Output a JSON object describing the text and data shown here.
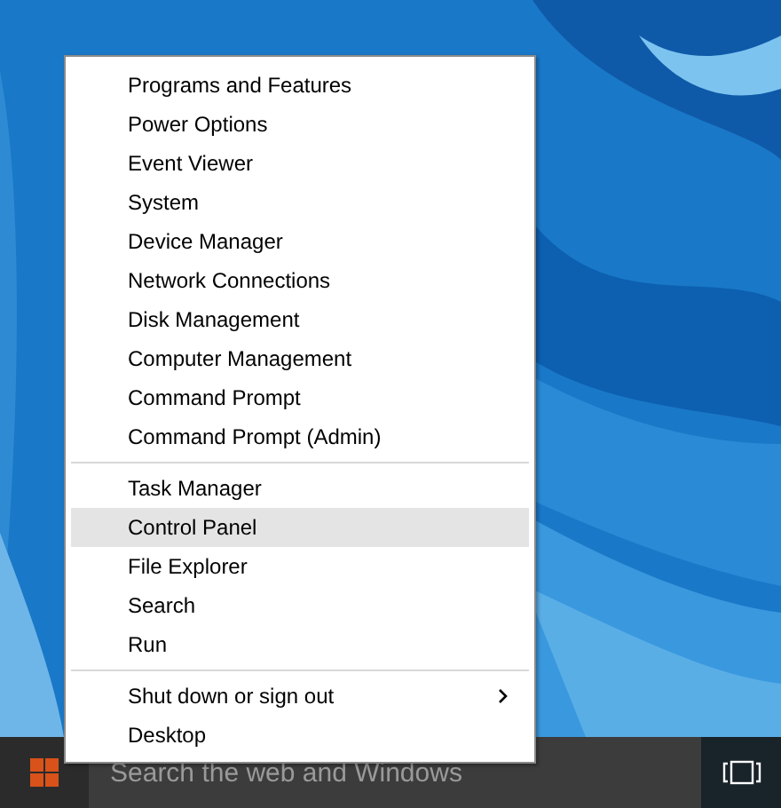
{
  "menu": {
    "groups": [
      {
        "items": [
          {
            "label": "Programs and Features",
            "selected": false,
            "has_submenu": false
          },
          {
            "label": "Power Options",
            "selected": false,
            "has_submenu": false
          },
          {
            "label": "Event Viewer",
            "selected": false,
            "has_submenu": false
          },
          {
            "label": "System",
            "selected": false,
            "has_submenu": false
          },
          {
            "label": "Device Manager",
            "selected": false,
            "has_submenu": false
          },
          {
            "label": "Network Connections",
            "selected": false,
            "has_submenu": false
          },
          {
            "label": "Disk Management",
            "selected": false,
            "has_submenu": false
          },
          {
            "label": "Computer Management",
            "selected": false,
            "has_submenu": false
          },
          {
            "label": "Command Prompt",
            "selected": false,
            "has_submenu": false
          },
          {
            "label": "Command Prompt (Admin)",
            "selected": false,
            "has_submenu": false
          }
        ]
      },
      {
        "items": [
          {
            "label": "Task Manager",
            "selected": false,
            "has_submenu": false
          },
          {
            "label": "Control Panel",
            "selected": true,
            "has_submenu": false
          },
          {
            "label": "File Explorer",
            "selected": false,
            "has_submenu": false
          },
          {
            "label": "Search",
            "selected": false,
            "has_submenu": false
          },
          {
            "label": "Run",
            "selected": false,
            "has_submenu": false
          }
        ]
      },
      {
        "items": [
          {
            "label": "Shut down or sign out",
            "selected": false,
            "has_submenu": true
          },
          {
            "label": "Desktop",
            "selected": false,
            "has_submenu": false
          }
        ]
      }
    ]
  },
  "taskbar": {
    "search": {
      "placeholder": "Search the web and Windows"
    }
  }
}
